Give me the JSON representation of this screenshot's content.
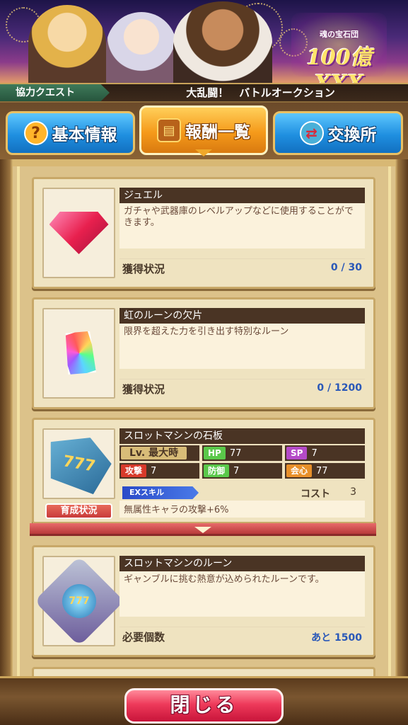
{
  "header": {
    "breadcrumb": "協力クエスト",
    "title": "大乱闘！　バトルオークション",
    "banner_logo_sub": "魂の宝石団",
    "banner_logo_main": "100億XXX"
  },
  "tabs": [
    {
      "label": "基本情報",
      "icon": "question-icon",
      "active": false
    },
    {
      "label": "報酬一覧",
      "icon": "treasure-chest-icon",
      "active": true
    },
    {
      "label": "交換所",
      "icon": "exchange-icon",
      "active": false
    }
  ],
  "rewards": [
    {
      "name": "ジュエル",
      "description": "ガチャや武器庫のレベルアップなどに使用することができます。",
      "status_label": "獲得状況",
      "status_value": "0 / 30",
      "icon": "jewel-icon"
    },
    {
      "name": "虹のルーンの欠片",
      "description": "限界を超えた力を引き出す特別なルーン",
      "status_label": "獲得状況",
      "status_value": "0 / 1200",
      "icon": "rainbow-rune-shard-icon"
    },
    {
      "name": "スロットマシンの石板",
      "icon": "slot-machine-slate-icon",
      "level_label": "Lv. 最大時",
      "stats": {
        "hp_label": "HP",
        "hp": "77",
        "sp_label": "SP",
        "sp": "7",
        "atk_label": "攻撃",
        "atk": "7",
        "def_label": "防御",
        "def": "7",
        "crit_label": "会心",
        "crit": "77"
      },
      "ex_skill_label": "EXスキル",
      "cost_label": "コスト",
      "cost_value": "3",
      "skill_description": "無属性キャラの攻撃+6%",
      "grow_button": "育成状況"
    },
    {
      "name": "スロットマシンのルーン",
      "description": "ギャンブルに挑む熱意が込められたルーンです。",
      "status_label": "必要個数",
      "status_value": "あと 1500",
      "icon": "slot-machine-rune-icon"
    }
  ],
  "footer": {
    "close_label": "閉じる"
  },
  "colors": {
    "accent_tab_active": "#f59a1a",
    "accent_tab": "#1f8fe0",
    "close_button": "#ee3a5a",
    "status_value": "#2a58b8"
  }
}
